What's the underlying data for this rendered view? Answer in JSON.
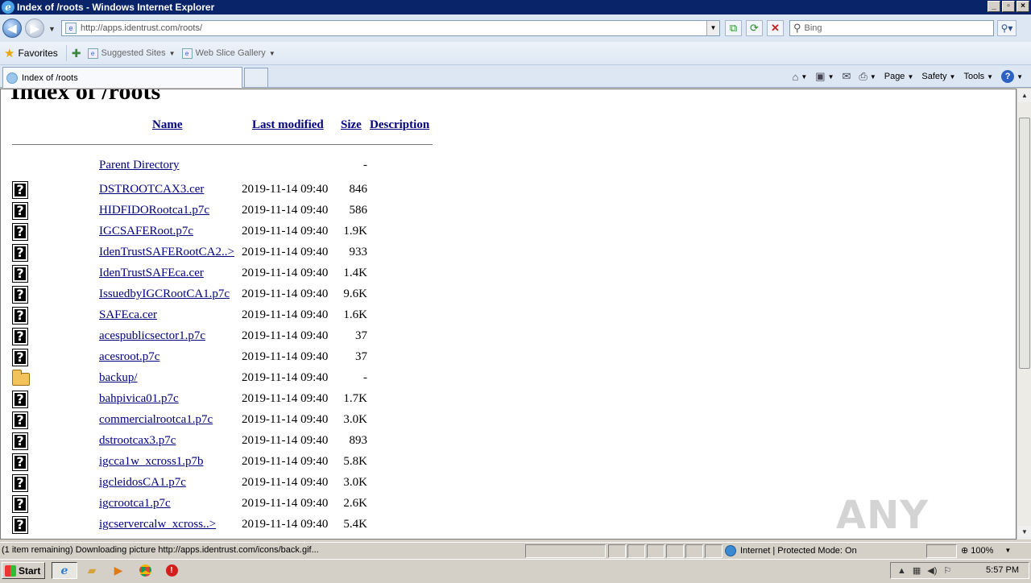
{
  "window": {
    "title": "Index of /roots - Windows Internet Explorer",
    "controls": [
      "_",
      "▫",
      "×"
    ]
  },
  "nav": {
    "url": "http://apps.identrust.com/roots/",
    "search_placeholder": "Bing"
  },
  "favorites": {
    "label": "Favorites",
    "links": [
      {
        "label": "Suggested Sites"
      },
      {
        "label": "Web Slice Gallery"
      }
    ]
  },
  "tab": {
    "title": "Index of /roots"
  },
  "commands": {
    "page": "Page",
    "safety": "Safety",
    "tools": "Tools",
    "help": "?"
  },
  "page": {
    "heading": "Index of /roots",
    "columns": {
      "name": "Name",
      "last_modified": "Last modified",
      "size": "Size",
      "description": "Description"
    },
    "parent": {
      "name": "Parent Directory",
      "size": "-"
    },
    "entries": [
      {
        "name": "DSTROOTCAX3.cer",
        "date": "2019-11-14 09:40",
        "size": "846",
        "type": "file"
      },
      {
        "name": "HIDFIDORootca1.p7c",
        "date": "2019-11-14 09:40",
        "size": "586",
        "type": "file"
      },
      {
        "name": "IGCSAFERoot.p7c",
        "date": "2019-11-14 09:40",
        "size": "1.9K",
        "type": "file"
      },
      {
        "name": "IdenTrustSAFERootCA2..>",
        "date": "2019-11-14 09:40",
        "size": "933",
        "type": "file"
      },
      {
        "name": "IdenTrustSAFEca.cer",
        "date": "2019-11-14 09:40",
        "size": "1.4K",
        "type": "file"
      },
      {
        "name": "IssuedbyIGCRootCA1.p7c",
        "date": "2019-11-14 09:40",
        "size": "9.6K",
        "type": "file"
      },
      {
        "name": "SAFEca.cer",
        "date": "2019-11-14 09:40",
        "size": "1.6K",
        "type": "file"
      },
      {
        "name": "acespublicsector1.p7c",
        "date": "2019-11-14 09:40",
        "size": "37",
        "type": "file"
      },
      {
        "name": "acesroot.p7c",
        "date": "2019-11-14 09:40",
        "size": "37",
        "type": "file"
      },
      {
        "name": "backup/",
        "date": "2019-11-14 09:40",
        "size": "-",
        "type": "folder"
      },
      {
        "name": "bahpivica01.p7c",
        "date": "2019-11-14 09:40",
        "size": "1.7K",
        "type": "file"
      },
      {
        "name": "commercialrootca1.p7c",
        "date": "2019-11-14 09:40",
        "size": "3.0K",
        "type": "file"
      },
      {
        "name": "dstrootcax3.p7c",
        "date": "2019-11-14 09:40",
        "size": "893",
        "type": "file"
      },
      {
        "name": "igcca1w_xcross1.p7b",
        "date": "2019-11-14 09:40",
        "size": "5.8K",
        "type": "file"
      },
      {
        "name": "igcleidosCA1.p7c",
        "date": "2019-11-14 09:40",
        "size": "3.0K",
        "type": "file"
      },
      {
        "name": "igcrootca1.p7c",
        "date": "2019-11-14 09:40",
        "size": "2.6K",
        "type": "file"
      },
      {
        "name": "igcservercalw_xcross..>",
        "date": "2019-11-14 09:40",
        "size": "5.4K",
        "type": "file"
      }
    ]
  },
  "watermark": "ANY RUN",
  "status": {
    "text": "(1 item remaining) Downloading picture http://apps.identrust.com/icons/back.gif...",
    "zone": "Internet | Protected Mode: On",
    "zoom": "100%"
  },
  "taskbar": {
    "start": "Start",
    "clock": "5:57 PM"
  }
}
